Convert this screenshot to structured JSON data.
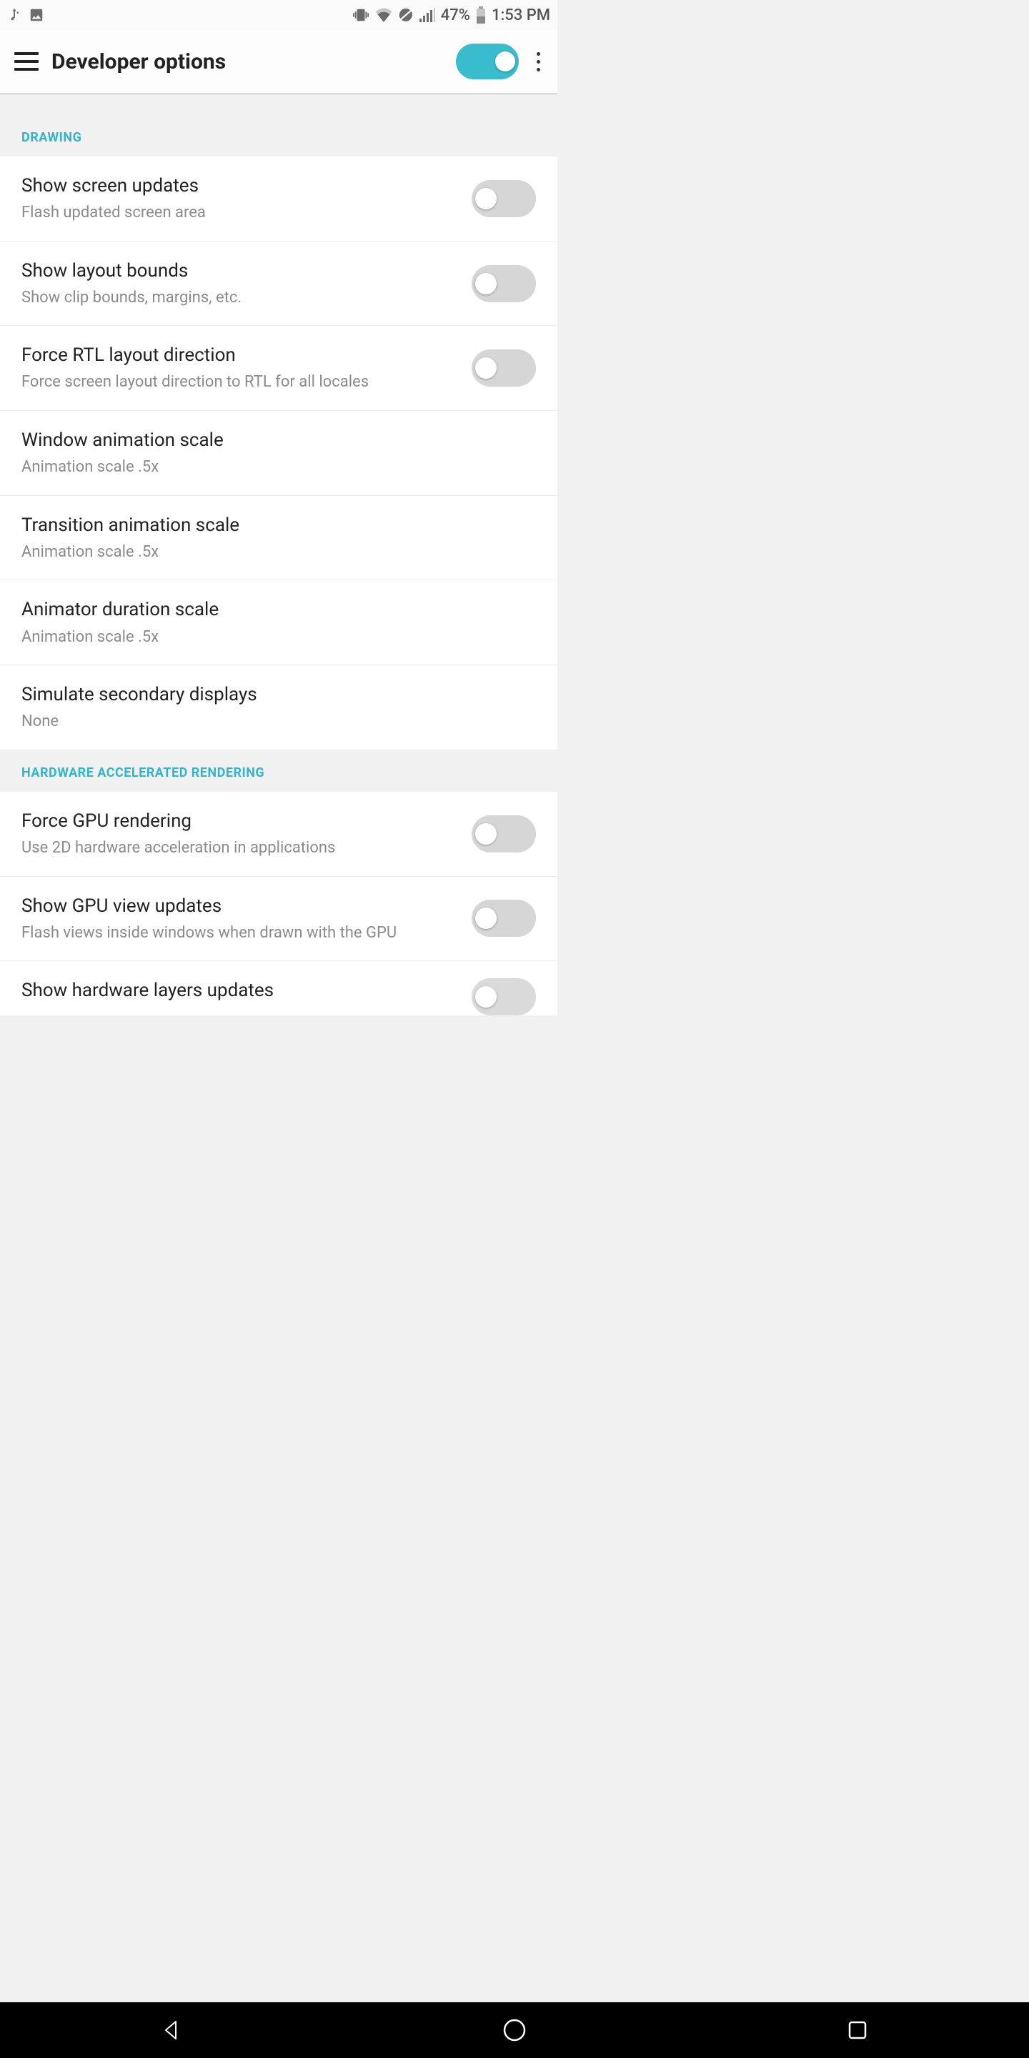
{
  "statusbar": {
    "battery_text": "47%",
    "time_text": "1:53 PM"
  },
  "appbar": {
    "title": "Developer options",
    "master_toggle": {
      "state": "on",
      "label": "ON"
    }
  },
  "sections": [
    {
      "header": "DRAWING",
      "rows": [
        {
          "title": "Show screen updates",
          "subtitle": "Flash updated screen area",
          "toggle": {
            "state": "off",
            "label": "OFF"
          }
        },
        {
          "title": "Show layout bounds",
          "subtitle": "Show clip bounds, margins, etc.",
          "toggle": {
            "state": "off",
            "label": "OFF"
          }
        },
        {
          "title": "Force RTL layout direction",
          "subtitle": "Force screen layout direction to RTL for all locales",
          "toggle": {
            "state": "off",
            "label": "OFF"
          }
        },
        {
          "title": "Window animation scale",
          "subtitle": "Animation scale .5x"
        },
        {
          "title": "Transition animation scale",
          "subtitle": "Animation scale .5x"
        },
        {
          "title": "Animator duration scale",
          "subtitle": "Animation scale .5x"
        },
        {
          "title": "Simulate secondary displays",
          "subtitle": "None"
        }
      ]
    },
    {
      "header": "HARDWARE ACCELERATED RENDERING",
      "rows": [
        {
          "title": "Force GPU rendering",
          "subtitle": "Use 2D hardware acceleration in applications",
          "toggle": {
            "state": "off",
            "label": "OFF"
          }
        },
        {
          "title": "Show GPU view updates",
          "subtitle": "Flash views inside windows when drawn with the GPU",
          "toggle": {
            "state": "off",
            "label": "OFF"
          }
        },
        {
          "title": "Show hardware layers updates",
          "subtitle": "",
          "toggle": {
            "state": "off",
            "label": "OFF"
          }
        }
      ]
    }
  ]
}
